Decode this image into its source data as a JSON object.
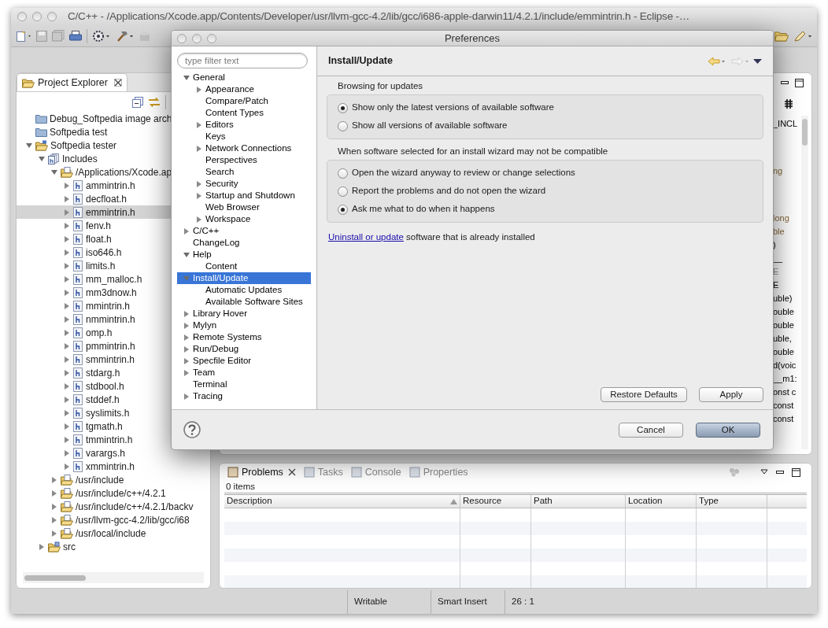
{
  "window": {
    "title": "C/C++ - /Applications/Xcode.app/Contents/Developer/usr/llvm-gcc-4.2/lib/gcc/i686-apple-darwin11/4.2.1/include/emmintrin.h - Eclipse -…"
  },
  "project_explorer": {
    "title": "Project Explorer",
    "tree": [
      {
        "label": "Debug_Softpedia image arch",
        "kind": "folder",
        "selected": false
      },
      {
        "label": "Softpedia test",
        "kind": "folder",
        "selected": false
      },
      {
        "label": "Softpedia tester",
        "kind": "project",
        "expanded": true,
        "selected": false,
        "children": [
          {
            "label": "Includes",
            "kind": "includes",
            "expanded": true,
            "selected": false,
            "children": [
              {
                "label": "/Applications/Xcode.ap",
                "kind": "include-folder",
                "expanded": true,
                "selected": false,
                "children": [
                  {
                    "label": "ammintrin.h",
                    "kind": "header",
                    "expanded": false,
                    "selected": false
                  },
                  {
                    "label": "decfloat.h",
                    "kind": "header",
                    "expanded": false,
                    "selected": false
                  },
                  {
                    "label": "emmintrin.h",
                    "kind": "header",
                    "expanded": false,
                    "selected": true
                  },
                  {
                    "label": "fenv.h",
                    "kind": "header",
                    "expanded": false,
                    "selected": false
                  },
                  {
                    "label": "float.h",
                    "kind": "header",
                    "expanded": false,
                    "selected": false
                  },
                  {
                    "label": "iso646.h",
                    "kind": "header",
                    "expanded": false,
                    "selected": false
                  },
                  {
                    "label": "limits.h",
                    "kind": "header",
                    "expanded": false,
                    "selected": false
                  },
                  {
                    "label": "mm_malloc.h",
                    "kind": "header",
                    "expanded": false,
                    "selected": false
                  },
                  {
                    "label": "mm3dnow.h",
                    "kind": "header",
                    "expanded": false,
                    "selected": false
                  },
                  {
                    "label": "mmintrin.h",
                    "kind": "header",
                    "expanded": false,
                    "selected": false
                  },
                  {
                    "label": "nmmintrin.h",
                    "kind": "header",
                    "expanded": false,
                    "selected": false
                  },
                  {
                    "label": "omp.h",
                    "kind": "header",
                    "expanded": false,
                    "selected": false
                  },
                  {
                    "label": "pmmintrin.h",
                    "kind": "header",
                    "expanded": false,
                    "selected": false
                  },
                  {
                    "label": "smmintrin.h",
                    "kind": "header",
                    "expanded": false,
                    "selected": false
                  },
                  {
                    "label": "stdarg.h",
                    "kind": "header",
                    "expanded": false,
                    "selected": false
                  },
                  {
                    "label": "stdbool.h",
                    "kind": "header",
                    "expanded": false,
                    "selected": false
                  },
                  {
                    "label": "stddef.h",
                    "kind": "header",
                    "expanded": false,
                    "selected": false
                  },
                  {
                    "label": "syslimits.h",
                    "kind": "header",
                    "expanded": false,
                    "selected": false
                  },
                  {
                    "label": "tgmath.h",
                    "kind": "header",
                    "expanded": false,
                    "selected": false
                  },
                  {
                    "label": "tmmintrin.h",
                    "kind": "header",
                    "expanded": false,
                    "selected": false
                  },
                  {
                    "label": "varargs.h",
                    "kind": "header",
                    "expanded": false,
                    "selected": false
                  },
                  {
                    "label": "xmmintrin.h",
                    "kind": "header",
                    "expanded": false,
                    "selected": false
                  }
                ]
              },
              {
                "label": "/usr/include",
                "kind": "include-folder",
                "expanded": false,
                "selected": false
              },
              {
                "label": "/usr/include/c++/4.2.1",
                "kind": "include-folder",
                "expanded": false,
                "selected": false
              },
              {
                "label": "/usr/include/c++/4.2.1/backv",
                "kind": "include-folder",
                "expanded": false,
                "selected": false
              },
              {
                "label": "/usr/llvm-gcc-4.2/lib/gcc/i68",
                "kind": "include-folder",
                "expanded": false,
                "selected": false
              },
              {
                "label": "/usr/local/include",
                "kind": "include-folder",
                "expanded": false,
                "selected": false
              }
            ]
          },
          {
            "label": "src",
            "kind": "source-folder",
            "expanded": false,
            "selected": false
          }
        ]
      }
    ]
  },
  "editor": {
    "blocks": [
      [
        {
          "text": "_INCL",
          "kind": "plain"
        }
      ],
      [
        {
          "text": "ng",
          "kind": "type"
        }
      ],
      [
        {
          "text": "long",
          "kind": "type"
        },
        {
          "text": "ble",
          "kind": "type"
        },
        {
          "text": ")",
          "kind": "plain"
        },
        {
          "text": "__",
          "kind": "plain"
        },
        {
          "text": "E",
          "kind": "macro"
        },
        {
          "text": "E",
          "kind": "plain"
        },
        {
          "text": "uble)",
          "kind": "plain"
        },
        {
          "text": "ouble",
          "kind": "plain"
        },
        {
          "text": "ouble",
          "kind": "plain"
        },
        {
          "text": "uble,",
          "kind": "plain"
        },
        {
          "text": "ouble",
          "kind": "plain"
        },
        {
          "text": "d(voic",
          "kind": "plain"
        },
        {
          "text": "__m1:",
          "kind": "plain"
        },
        {
          "text": "onst c",
          "kind": "plain"
        },
        {
          "text": "const",
          "kind": "plain"
        },
        {
          "text": "const",
          "kind": "plain"
        }
      ]
    ]
  },
  "problems_panel": {
    "tabs": [
      {
        "label": "Problems",
        "selected": true
      },
      {
        "label": "Tasks",
        "selected": false
      },
      {
        "label": "Console",
        "selected": false
      },
      {
        "label": "Properties",
        "selected": false
      }
    ],
    "summary": "0 items",
    "columns": [
      {
        "label": "Description",
        "sorted": true
      },
      {
        "label": "Resource",
        "sorted": false
      },
      {
        "label": "Path",
        "sorted": false
      },
      {
        "label": "Location",
        "sorted": false
      },
      {
        "label": "Type",
        "sorted": false
      }
    ]
  },
  "status_bar": [
    "Writable",
    "Smart Insert",
    "26 : 1"
  ],
  "preferences_dialog": {
    "title": "Preferences",
    "filter": {
      "placeholder": "type filter text"
    },
    "tree": [
      {
        "label": "General",
        "expanded": true,
        "selected": false,
        "children": [
          {
            "label": "Appearance",
            "expanded": false,
            "selected": false
          },
          {
            "label": "Compare/Patch",
            "selected": false
          },
          {
            "label": "Content Types",
            "selected": false
          },
          {
            "label": "Editors",
            "expanded": false,
            "selected": false
          },
          {
            "label": "Keys",
            "selected": false
          },
          {
            "label": "Network Connections",
            "expanded": false,
            "selected": false
          },
          {
            "label": "Perspectives",
            "selected": false
          },
          {
            "label": "Search",
            "selected": false
          },
          {
            "label": "Security",
            "expanded": false,
            "selected": false
          },
          {
            "label": "Startup and Shutdown",
            "expanded": false,
            "selected": false
          },
          {
            "label": "Web Browser",
            "selected": false
          },
          {
            "label": "Workspace",
            "expanded": false,
            "selected": false
          }
        ]
      },
      {
        "label": "C/C++",
        "expanded": false,
        "selected": false
      },
      {
        "label": "ChangeLog",
        "selected": false
      },
      {
        "label": "Help",
        "expanded": true,
        "selected": false,
        "children": [
          {
            "label": "Content",
            "selected": false
          }
        ]
      },
      {
        "label": "Install/Update",
        "expanded": true,
        "selected": true,
        "children": [
          {
            "label": "Automatic Updates",
            "selected": false
          },
          {
            "label": "Available Software Sites",
            "selected": false
          }
        ]
      },
      {
        "label": "Library Hover",
        "expanded": false,
        "selected": false
      },
      {
        "label": "Mylyn",
        "expanded": false,
        "selected": false
      },
      {
        "label": "Remote Systems",
        "expanded": false,
        "selected": false
      },
      {
        "label": "Run/Debug",
        "expanded": false,
        "selected": false
      },
      {
        "label": "Specfile Editor",
        "expanded": false,
        "selected": false
      },
      {
        "label": "Team",
        "expanded": false,
        "selected": false
      },
      {
        "label": "Terminal",
        "selected": false
      },
      {
        "label": "Tracing",
        "expanded": false,
        "selected": false
      }
    ],
    "page": {
      "title": "Install/Update",
      "groups": [
        {
          "label": "Browsing for updates",
          "options": [
            {
              "label": "Show only the latest versions of available software",
              "selected": true
            },
            {
              "label": "Show all versions of available software",
              "selected": false
            }
          ]
        },
        {
          "label": "When software selected for an install wizard may not be compatible",
          "options": [
            {
              "label": "Open the wizard anyway to review or change selections",
              "selected": false
            },
            {
              "label": "Report the problems and do not open the wizard",
              "selected": false
            },
            {
              "label": "Ask me what to do when it happens",
              "selected": true
            }
          ]
        }
      ],
      "note": {
        "link": "Uninstall or update",
        "text": "software that is already installed"
      },
      "buttons": [
        "Restore Defaults",
        "Apply"
      ]
    },
    "buttons": [
      {
        "label": "Cancel",
        "default": false
      },
      {
        "label": "OK",
        "default": true
      }
    ]
  }
}
